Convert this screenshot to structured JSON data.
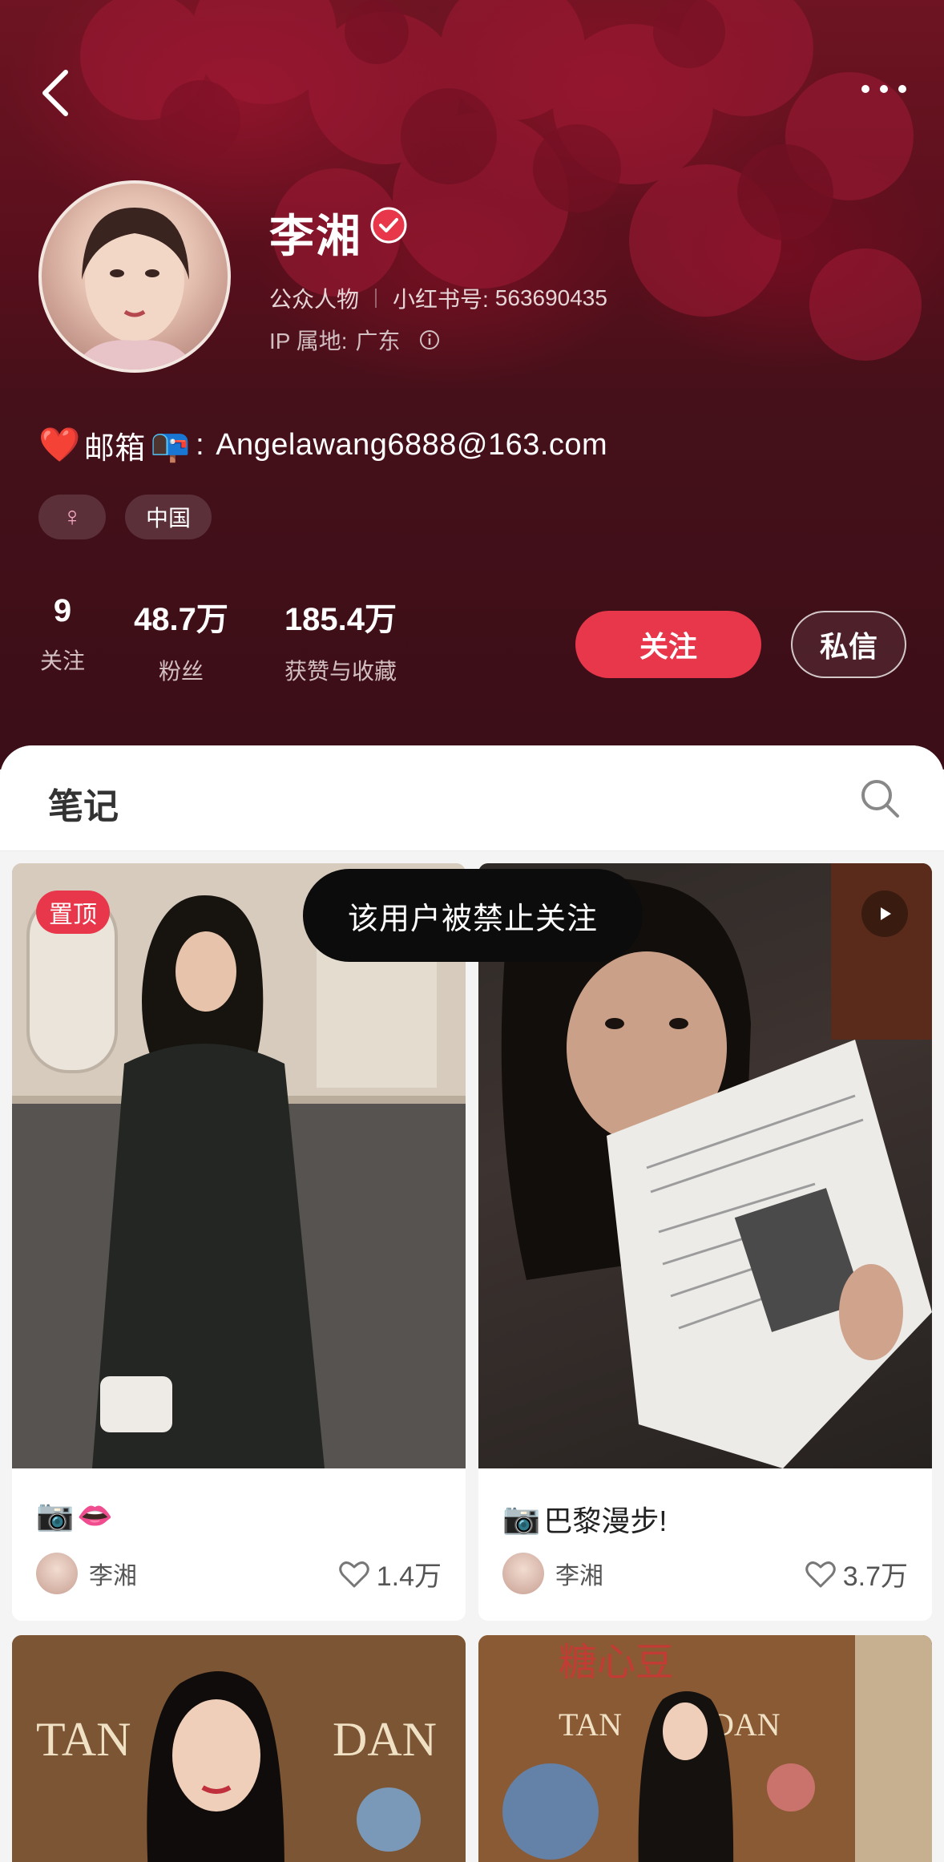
{
  "profile": {
    "name": "李湘",
    "category": "公众人物",
    "red_id_label": "小红书号:",
    "red_id": "563690435",
    "ip_label": "IP 属地:",
    "ip_location": "广东",
    "bio_heart": "❤️",
    "bio_label": "邮箱",
    "bio_mailbox": "📭",
    "bio_colon": ":",
    "bio_email": "Angelawang6888@163.com",
    "tags": {
      "gender": "♀",
      "region": "中国"
    }
  },
  "stats": [
    {
      "value": "9",
      "label": "关注"
    },
    {
      "value": "48.7万",
      "label": "粉丝"
    },
    {
      "value": "185.4万",
      "label": "获赞与收藏"
    }
  ],
  "actions": {
    "follow_label": "关注",
    "message_label": "私信"
  },
  "notes_tab": {
    "label": "笔记"
  },
  "cards": [
    {
      "pinned_label": "置顶",
      "camera": "📷",
      "title": "👄",
      "author": "李湘",
      "likes": "1.4万"
    },
    {
      "camera": "📷",
      "title": "巴黎漫步!",
      "author": "李湘",
      "likes": "3.7万",
      "is_video": true
    },
    {
      "sign_text": "TAN",
      "sign_text_2": "DAN"
    },
    {
      "sign_top": "糖心豆",
      "sign_text": "TAN",
      "sign_text_2": "DAN"
    }
  ],
  "toast": {
    "text": "该用户被禁止关注"
  },
  "icons": [
    "back-arrow-icon",
    "more-dots-icon",
    "verified-icon",
    "info-icon",
    "search-icon",
    "play-icon",
    "heart-outline-icon"
  ],
  "colors": {
    "accent": "#e8364a",
    "header_bg": "#45101a",
    "verified": "#e8364a"
  }
}
